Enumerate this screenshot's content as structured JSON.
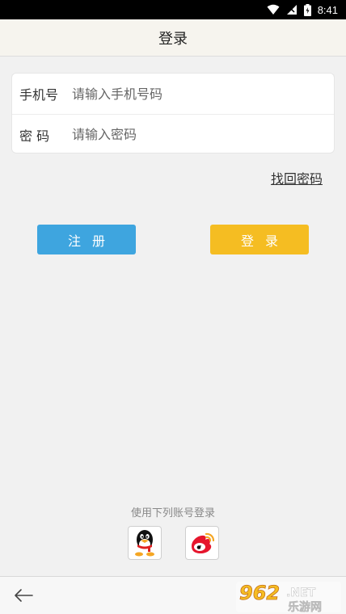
{
  "status_bar": {
    "time": "8:41"
  },
  "header": {
    "title": "登录"
  },
  "form": {
    "phone": {
      "label": "手机号",
      "placeholder": "请输入手机号码",
      "value": ""
    },
    "password": {
      "label": "密 码",
      "placeholder": "请输入密码",
      "value": ""
    }
  },
  "links": {
    "forgot_password": "找回密码"
  },
  "buttons": {
    "register": "注册",
    "login": "登录"
  },
  "third_party": {
    "label": "使用下列账号登录",
    "providers": [
      {
        "name": "qq-icon"
      },
      {
        "name": "weibo-icon"
      }
    ]
  },
  "watermark": {
    "text_top": "962",
    "text_domain": ".NET",
    "text_bottom": "乐游网"
  },
  "colors": {
    "register_button": "#3ea5df",
    "login_button": "#f5bd22",
    "background": "#f1f1f1",
    "header_bg": "#f6f4ee"
  }
}
